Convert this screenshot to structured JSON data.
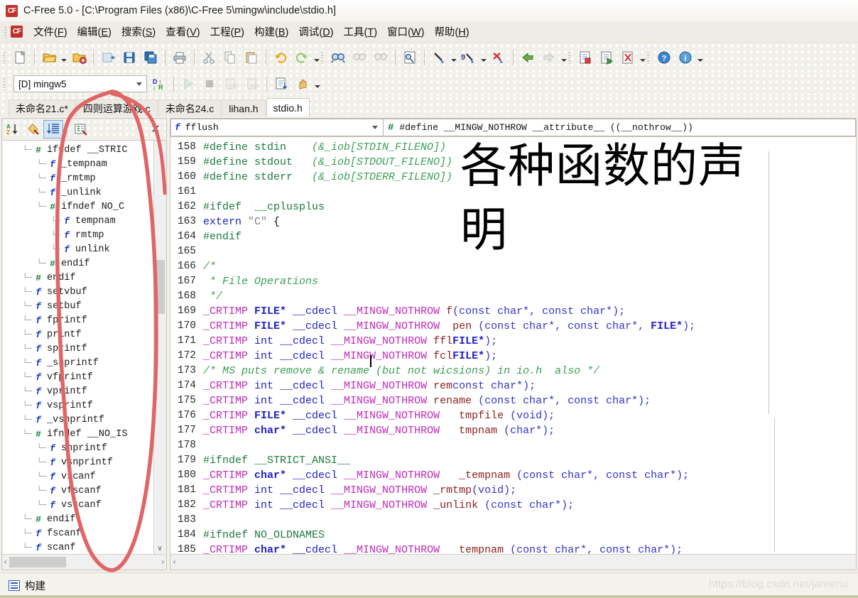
{
  "window": {
    "title": "C-Free 5.0 - [C:\\Program Files (x86)\\C-Free 5\\mingw\\include\\stdio.h]",
    "logo_text": "CF"
  },
  "menubar": {
    "items": [
      {
        "label": "文件",
        "accel": "F"
      },
      {
        "label": "编辑",
        "accel": "E"
      },
      {
        "label": "搜索",
        "accel": "S"
      },
      {
        "label": "查看",
        "accel": "V"
      },
      {
        "label": "工程",
        "accel": "P"
      },
      {
        "label": "构建",
        "accel": "B"
      },
      {
        "label": "调试",
        "accel": "D"
      },
      {
        "label": "工具",
        "accel": "T"
      },
      {
        "label": "窗口",
        "accel": "W"
      },
      {
        "label": "帮助",
        "accel": "H"
      }
    ]
  },
  "toolbar": {
    "row1_icons": [
      "new-file-icon",
      "open-folder-icon",
      "open-dropdown-caret",
      "open-project-icon",
      "save-as-icon",
      "save-icon",
      "save-all-icon",
      "print-icon",
      "cut-icon",
      "copy-icon",
      "paste-icon",
      "undo-icon",
      "redo-icon",
      "undo-dropdown-caret",
      "find-icon",
      "find-next-icon",
      "find-prev-icon",
      "find-in-files-icon",
      "build-icon",
      "build-dropdown-caret",
      "rebuild-icon",
      "rebuild-dropdown-caret",
      "stop-build-icon",
      "back-icon",
      "forward-icon",
      "nav-dropdown-caret",
      "compile-icon",
      "compile-run-icon",
      "clean-icon",
      "run-dropdown-caret",
      "help-icon",
      "about-icon",
      "help-dropdown-caret"
    ],
    "project_combo_value": "[D] mingw5",
    "row2_icons": [
      "target-config-icon",
      "refresh-symbols-icon",
      "run-icon",
      "stop-icon",
      "step-over-icon",
      "step-into-icon",
      "goto-line-icon",
      "pause-icon",
      "debug-dropdown-caret"
    ]
  },
  "tabs": [
    {
      "label": "未命名21.c*",
      "active": false
    },
    {
      "label": "四则运算游戏.c",
      "active": false
    },
    {
      "label": "未命名24.c",
      "active": false
    },
    {
      "label": "lihan.h",
      "active": false
    },
    {
      "label": "stdio.h",
      "active": true
    }
  ],
  "left_panel": {
    "toolbar_icons": [
      "sort-alphabetical-icon",
      "group-by-type-icon",
      "sort-by-position-icon",
      "symbol-filter-icon"
    ],
    "close_label": "✕",
    "tree": [
      {
        "indent": 1,
        "kind": "hash",
        "label": "ifndef __STRIC"
      },
      {
        "indent": 2,
        "kind": "fn",
        "label": "_tempnam"
      },
      {
        "indent": 2,
        "kind": "fn",
        "label": "_rmtmp"
      },
      {
        "indent": 2,
        "kind": "fn",
        "label": "_unlink"
      },
      {
        "indent": 2,
        "kind": "hash",
        "label": "ifndef NO_C"
      },
      {
        "indent": 3,
        "kind": "fn",
        "label": "tempnam"
      },
      {
        "indent": 3,
        "kind": "fn",
        "label": "rmtmp"
      },
      {
        "indent": 3,
        "kind": "fn",
        "label": "unlink"
      },
      {
        "indent": 2,
        "kind": "hash",
        "label": "endif"
      },
      {
        "indent": 1,
        "kind": "hash",
        "label": "endif"
      },
      {
        "indent": 1,
        "kind": "fn",
        "label": "setvbuf"
      },
      {
        "indent": 1,
        "kind": "fn",
        "label": "setbuf"
      },
      {
        "indent": 1,
        "kind": "fn",
        "label": "fprintf"
      },
      {
        "indent": 1,
        "kind": "fn",
        "label": "printf"
      },
      {
        "indent": 1,
        "kind": "fn",
        "label": "sprintf"
      },
      {
        "indent": 1,
        "kind": "fn",
        "label": "_snprintf"
      },
      {
        "indent": 1,
        "kind": "fn",
        "label": "vfprintf"
      },
      {
        "indent": 1,
        "kind": "fn",
        "label": "vprintf"
      },
      {
        "indent": 1,
        "kind": "fn",
        "label": "vsprintf"
      },
      {
        "indent": 1,
        "kind": "fn",
        "label": "_vsnprintf"
      },
      {
        "indent": 1,
        "kind": "hash",
        "label": "ifndef __NO_IS"
      },
      {
        "indent": 2,
        "kind": "fn",
        "label": "snprintf"
      },
      {
        "indent": 2,
        "kind": "fn",
        "label": "vsnprintf"
      },
      {
        "indent": 2,
        "kind": "fn",
        "label": "vscanf"
      },
      {
        "indent": 2,
        "kind": "fn",
        "label": "vfscanf"
      },
      {
        "indent": 2,
        "kind": "fn",
        "label": "vsscanf"
      },
      {
        "indent": 1,
        "kind": "hash",
        "label": "endif"
      },
      {
        "indent": 1,
        "kind": "fn",
        "label": "fscanf"
      },
      {
        "indent": 1,
        "kind": "fn",
        "label": "scanf"
      }
    ],
    "scroll_left_arrow": "‹",
    "scroll_right_arrow": "›",
    "scroll_up_arrow": "∧",
    "scroll_down_arrow": "∨"
  },
  "editor": {
    "symbol_combo_value": "fflush",
    "definition_bar_value": "#define __MINGW_NOTHROW __attribute__ ((__nothrow__))",
    "hscroll_left_arrow": "‹",
    "first_line_number": 158,
    "lines": [
      {
        "n": 158,
        "tokens": [
          [
            "k-pp",
            "#define stdin    "
          ],
          [
            "k-cmt",
            "(&_iob[STDIN_FILENO])"
          ]
        ]
      },
      {
        "n": 159,
        "tokens": [
          [
            "k-pp",
            "#define stdout   "
          ],
          [
            "k-cmt",
            "(&_iob[STDOUT_FILENO])"
          ]
        ]
      },
      {
        "n": 160,
        "tokens": [
          [
            "k-pp",
            "#define stderr   "
          ],
          [
            "k-cmt",
            "(&_iob[STDERR_FILENO])"
          ]
        ]
      },
      {
        "n": 161,
        "tokens": []
      },
      {
        "n": 162,
        "tokens": [
          [
            "k-pp",
            "#ifdef  __cplusplus"
          ]
        ]
      },
      {
        "n": 163,
        "tokens": [
          [
            "k-kw",
            "extern "
          ],
          [
            "k-str",
            "\"C\""
          ],
          [
            "k-plain",
            " {"
          ]
        ]
      },
      {
        "n": 164,
        "tokens": [
          [
            "k-pp",
            "#endif"
          ]
        ]
      },
      {
        "n": 165,
        "tokens": []
      },
      {
        "n": 166,
        "tokens": [
          [
            "k-cmt",
            "/*"
          ]
        ]
      },
      {
        "n": 167,
        "tokens": [
          [
            "k-cmt",
            " * File Operations"
          ]
        ]
      },
      {
        "n": 168,
        "tokens": [
          [
            "k-cmt",
            " */"
          ]
        ]
      },
      {
        "n": 169,
        "tokens": [
          [
            "k-macro",
            "_CRTIMP "
          ],
          [
            "k-type",
            "FILE* "
          ],
          [
            "k-kw",
            "__cdecl "
          ],
          [
            "k-macro",
            "__MINGW_NOTHROW "
          ],
          [
            "k-fn",
            "f"
          ],
          [
            "k-param",
            "(const char*, const char*);"
          ]
        ]
      },
      {
        "n": 170,
        "tokens": [
          [
            "k-macro",
            "_CRTIMP "
          ],
          [
            "k-type",
            "FILE* "
          ],
          [
            "k-kw",
            "__cdecl "
          ],
          [
            "k-macro",
            "__MINGW_NOTHROW "
          ],
          [
            "k-fn",
            " pen "
          ],
          [
            "k-param",
            "(const char*, const char*, "
          ],
          [
            "k-type",
            "FILE*"
          ],
          [
            "k-param",
            ");"
          ]
        ]
      },
      {
        "n": 171,
        "tokens": [
          [
            "k-macro",
            "_CRTIMP "
          ],
          [
            "k-kw",
            "int "
          ],
          [
            "k-kw",
            "__cdecl "
          ],
          [
            "k-macro",
            "__MINGW_NOTHROW "
          ],
          [
            "k-fn",
            "ffl"
          ],
          [
            "k-type",
            "FILE*"
          ],
          [
            "k-param",
            ");"
          ]
        ]
      },
      {
        "n": 172,
        "tokens": [
          [
            "k-macro",
            "_CRTIMP "
          ],
          [
            "k-kw",
            "int "
          ],
          [
            "k-kw",
            "__cdecl "
          ],
          [
            "k-macro",
            "__MINGW_NOTHROW "
          ],
          [
            "k-fn",
            "fcl"
          ],
          [
            "k-type",
            "FILE*"
          ],
          [
            "k-param",
            ");"
          ]
        ]
      },
      {
        "n": 173,
        "tokens": [
          [
            "k-cmt",
            "/* MS puts remove & rename (but not wicsions) in io.h  also */"
          ]
        ]
      },
      {
        "n": 174,
        "tokens": [
          [
            "k-macro",
            "_CRTIMP "
          ],
          [
            "k-kw",
            "int "
          ],
          [
            "k-kw",
            "__cdecl "
          ],
          [
            "k-macro",
            "__MINGW_NOTHROW "
          ],
          [
            "k-fn",
            "rem"
          ],
          [
            "k-param",
            "const char*);"
          ]
        ]
      },
      {
        "n": 175,
        "tokens": [
          [
            "k-macro",
            "_CRTIMP "
          ],
          [
            "k-kw",
            "int "
          ],
          [
            "k-kw",
            "__cdecl "
          ],
          [
            "k-macro",
            "__MINGW_NOTHROW "
          ],
          [
            "k-fn",
            "rename "
          ],
          [
            "k-param",
            "(const char*, const char*);"
          ]
        ]
      },
      {
        "n": 176,
        "tokens": [
          [
            "k-macro",
            "_CRTIMP "
          ],
          [
            "k-type",
            "FILE* "
          ],
          [
            "k-kw",
            "__cdecl "
          ],
          [
            "k-macro",
            "__MINGW_NOTHROW "
          ],
          [
            "k-fn",
            "  tmpfile "
          ],
          [
            "k-param",
            "(void);"
          ]
        ]
      },
      {
        "n": 177,
        "tokens": [
          [
            "k-macro",
            "_CRTIMP "
          ],
          [
            "k-type",
            "char* "
          ],
          [
            "k-kw",
            "__cdecl "
          ],
          [
            "k-macro",
            "__MINGW_NOTHROW "
          ],
          [
            "k-fn",
            "  tmpnam "
          ],
          [
            "k-param",
            "(char*);"
          ]
        ]
      },
      {
        "n": 178,
        "tokens": []
      },
      {
        "n": 179,
        "tokens": [
          [
            "k-pp",
            "#ifndef __STRICT_ANSI__"
          ]
        ]
      },
      {
        "n": 180,
        "tokens": [
          [
            "k-macro",
            "_CRTIMP "
          ],
          [
            "k-type",
            "char* "
          ],
          [
            "k-kw",
            "__cdecl "
          ],
          [
            "k-macro",
            "__MINGW_NOTHROW "
          ],
          [
            "k-fn",
            "  _tempnam "
          ],
          [
            "k-param",
            "(const char*, const char*);"
          ]
        ]
      },
      {
        "n": 181,
        "tokens": [
          [
            "k-macro",
            "_CRTIMP "
          ],
          [
            "k-kw",
            "int "
          ],
          [
            "k-kw",
            "__cdecl "
          ],
          [
            "k-macro",
            "__MINGW_NOTHROW "
          ],
          [
            "k-fn",
            "_rmtmp"
          ],
          [
            "k-param",
            "(void);"
          ]
        ]
      },
      {
        "n": 182,
        "tokens": [
          [
            "k-macro",
            "_CRTIMP "
          ],
          [
            "k-kw",
            "int "
          ],
          [
            "k-kw",
            "__cdecl "
          ],
          [
            "k-macro",
            "__MINGW_NOTHROW "
          ],
          [
            "k-fn",
            "_unlink "
          ],
          [
            "k-param",
            "(const char*);"
          ]
        ]
      },
      {
        "n": 183,
        "tokens": []
      },
      {
        "n": 184,
        "tokens": [
          [
            "k-pp",
            "#ifndef NO_OLDNAMES"
          ]
        ]
      },
      {
        "n": 185,
        "tokens": [
          [
            "k-macro",
            "_CRTIMP "
          ],
          [
            "k-type",
            "char* "
          ],
          [
            "k-kw",
            "__cdecl "
          ],
          [
            "k-macro",
            "__MINGW_NOTHROW "
          ],
          [
            "k-fn",
            "  tempnam "
          ],
          [
            "k-param",
            "(const char*, const char*);"
          ]
        ]
      }
    ]
  },
  "annotation": {
    "note_line1": "各种函数的声",
    "note_line2": "明",
    "circle_color": "#e06666"
  },
  "statusbar": {
    "label": "构建",
    "icon": "build-output-icon"
  },
  "watermark": "https://blog.csdn.net/jamenu"
}
